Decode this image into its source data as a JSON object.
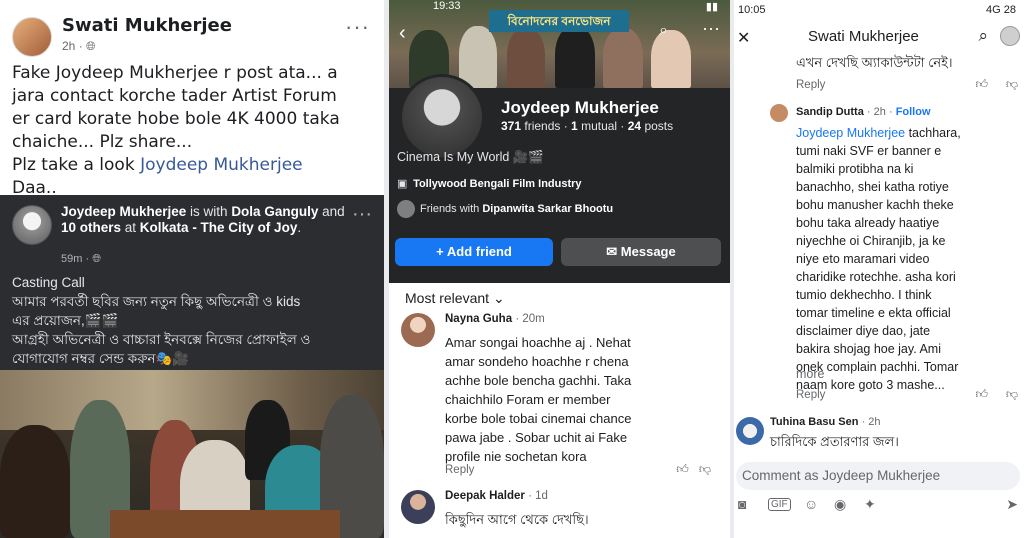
{
  "left_post": {
    "author": "Swati Mukherjee",
    "time": "2h",
    "privacy_icon": "globe-icon",
    "text_lines": [
      "Fake Joydeep Mukherjee r post ata... a",
      "jara contact korche tader Artist Forum",
      "er card korate hobe bole 4K 4000 taka",
      "chaiche... Plz share..."
    ],
    "text_last_prefix": "Plz take a look ",
    "text_last_link": "Joydeep Mukherjee",
    "text_end": "Daa.."
  },
  "shared_post": {
    "author": "Joydeep Mukherjee",
    "with_text": " is with ",
    "tag1": "Dola Ganguly",
    "and_text": " and ",
    "tag2": "10 others",
    "at_text": " at ",
    "place": "Kolkata - The City of Joy",
    "dot": ".",
    "time": "59m",
    "body_lines": [
      "Casting Call",
      "আমার পরবর্তী ছবির জন্য নতুন কিছু অভিনেত্রী ও kids",
      "এর প্রয়োজন,🎬🎬",
      "আগ্রহী অভিনেত্রী ও বাচ্চারা ইনবক্সে নিজের প্রোফাইল ও",
      "যোগাযোগ নম্বর সেন্ড করুন🎭🎥"
    ]
  },
  "profile": {
    "status_time": "19:33",
    "cover_banner": "বিনোদনের বনভোজন",
    "name": "Joydeep Mukherjee",
    "friends": "371",
    "friends_label": " friends · ",
    "mutual": "1",
    "mutual_label": " mutual · ",
    "posts": "24",
    "posts_label": " posts",
    "bio": "Cinema Is My World 🎥🎬",
    "work": "Tollywood Bengali Film Industry",
    "friends_with_prefix": "Friends with ",
    "friends_with_name": "Dipanwita Sarkar Bhootu",
    "add_friend": "Add friend",
    "message": "Message"
  },
  "comments_mid": {
    "sort_label": "Most relevant",
    "items": [
      {
        "name": "Nayna Guha",
        "time": "20m",
        "lines": [
          "Amar songai hoachhe aj . Nehat",
          "amar sondeho hoachhe r chena",
          "achhe bole bencha gachhi.  Taka",
          "chaichhilo Foram er member",
          "korbe bole tobai cinemai chance",
          "pawa jabe . Sobar uchit ai Fake",
          "profile nie sochetan kora"
        ],
        "reply": "Reply"
      },
      {
        "name": "Deepak Halder",
        "time": "1d",
        "lines": [
          "কিছুদিন আগে থেকে দেখছি।"
        ]
      }
    ]
  },
  "right_panel": {
    "status_time": "10:05",
    "status_right": "4G 28",
    "title": "Swati Mukherjee",
    "top_text": "এখন দেখছি অ্যাকাউন্টটা নেই।",
    "reply1": "Reply",
    "reply_author": "Sandip Dutta",
    "reply_time": "2h",
    "follow": "Follow",
    "body_link": "Joydeep Mukherjee",
    "body_lines": [
      " tachhara,",
      "tumi naki SVF er banner e",
      "balmiki protibha na ki",
      "banachho, shei katha rotiye",
      "bohu manusher kachh theke",
      "bohu taka already haatiye",
      "niyechhe oi Chiranjib, ja ke",
      "niye eto maramari video",
      "charidike rotechhe. asha kori",
      "tumio dekhechho. I think",
      "tomar timeline e ekta official",
      "disclaimer diye dao, jate",
      "bakira shojag hoe jay. Ami",
      "onek complain pachhi. Tomar",
      "naam kore goto 3 mashe..."
    ],
    "more": "more",
    "reply2": "Reply",
    "c2_name": "Tuhina Basu Sen",
    "c2_time": "2h",
    "c2_text": "চারিদিকে প্রতারণার জল।",
    "comment_placeholder": "Comment as Joydeep Mukherjee"
  }
}
